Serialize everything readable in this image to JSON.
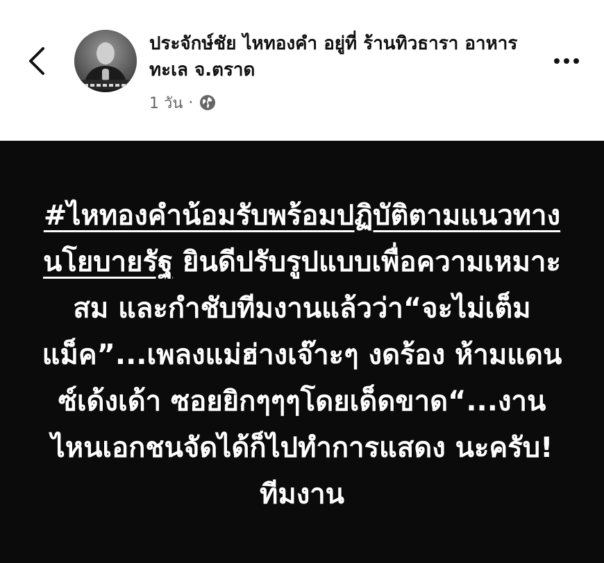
{
  "header": {
    "author_name": "ประจักษ์ชัย ไหทองคำ อยู่ที่ ร้านทิวธารา อาหารทะเล จ.ตราด",
    "time_ago": "1 วัน",
    "separator": "·",
    "privacy_icon": "globe-icon",
    "back_icon": "chevron-left-icon",
    "more_icon": "more-horizontal-icon"
  },
  "post": {
    "hashtag": "#ไหทองคำน้อมรับพร้อมปฏิบัติตามแนวทางนโยบายรัฐ",
    "text": " ยินดีปรับรูปแบบเพื่อความเหมาะสม และกำชับทีมงานแล้วว่า“จะไม่เต็มแม็ค”...เพลงแม่ฮ่างเจ๊าะๆ งดร้อง ห้ามแดนซ์เด้งเด้า ซอยยิกๆๆๆโดยเด็ดขาด“...งานไหนเอกชนจัดได้ก็ไปทำการแสดง นะครับ!ทีมงาน",
    "background_color": "#0b0b0b",
    "text_color": "#ffffff"
  }
}
